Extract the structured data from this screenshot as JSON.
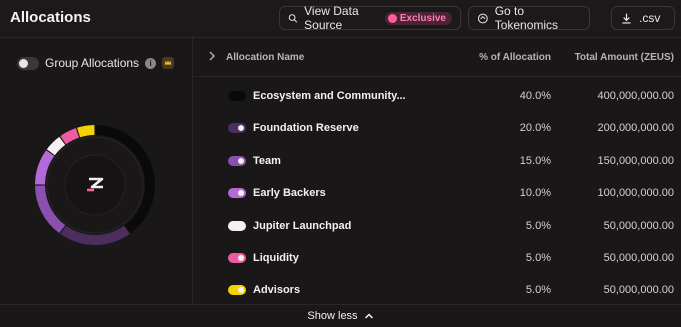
{
  "header": {
    "title": "Allocations",
    "view_source_label": "View Data Source",
    "exclusive_badge": "Exclusive",
    "tokenomics_label": "Go to Tokenomics",
    "csv_label": ".csv"
  },
  "left_panel": {
    "group_label": "Group Allocations",
    "info_glyph": "i"
  },
  "table": {
    "col_name": "Allocation Name",
    "col_pct": "% of Allocation",
    "col_amount": "Total Amount (ZEUS)",
    "rows": [
      {
        "name": "Ecosystem and Community...",
        "pct": "40.0%",
        "amount": "400,000,000.00",
        "color": "#0a0a0a"
      },
      {
        "name": "Foundation Reserve",
        "pct": "20.0%",
        "amount": "200,000,000.00",
        "color": "#4b2d5e"
      },
      {
        "name": "Team",
        "pct": "15.0%",
        "amount": "150,000,000.00",
        "color": "#8b4fb0"
      },
      {
        "name": "Early Backers",
        "pct": "10.0%",
        "amount": "100,000,000.00",
        "color": "#b36ad8"
      },
      {
        "name": "Jupiter Launchpad",
        "pct": "5.0%",
        "amount": "50,000,000.00",
        "color": "#f3f0f3"
      },
      {
        "name": "Liquidity",
        "pct": "5.0%",
        "amount": "50,000,000.00",
        "color": "#ee5ba0"
      },
      {
        "name": "Advisors",
        "pct": "5.0%",
        "amount": "50,000,000.00",
        "color": "#f5d300"
      }
    ]
  },
  "footer": {
    "show_less_label": "Show less"
  },
  "colors": {
    "accent": "#ff5c9a",
    "background": "#1a1718"
  }
}
